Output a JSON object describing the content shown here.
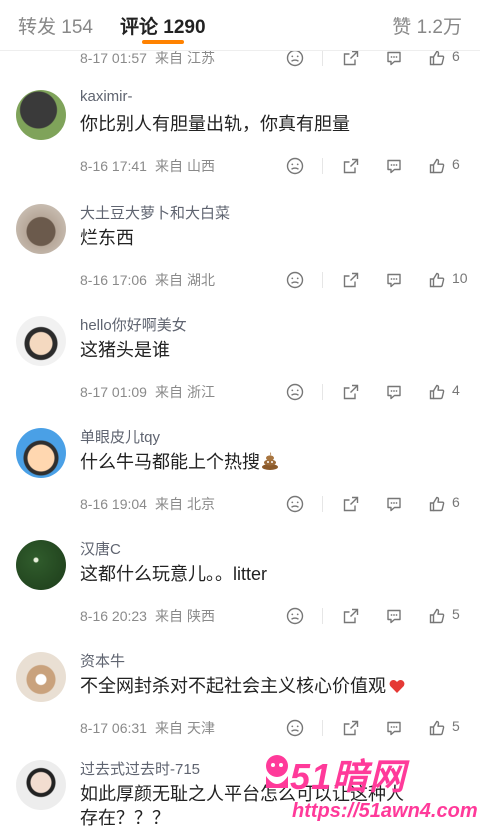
{
  "tabs": {
    "repost_label": "转发 154",
    "comments_label": "评论 1290",
    "likes_label": "赞 1.2万",
    "accent": "#ff8200"
  },
  "comments": [
    {
      "username": "",
      "text": "",
      "date": "8-17 01:57",
      "from": "来自",
      "location": "江苏",
      "likes": "6"
    },
    {
      "username": "kaximir-",
      "text": "你比别人有胆量出轨，你真有胆量",
      "date": "8-16 17:41",
      "from": "来自",
      "location": "山西",
      "likes": "6"
    },
    {
      "username": "大土豆大萝卜和大白菜",
      "text": "烂东西",
      "date": "8-16 17:06",
      "from": "来自",
      "location": "湖北",
      "likes": "10"
    },
    {
      "username": "hello你好啊美女",
      "text": "这猪头是谁",
      "date": "8-17 01:09",
      "from": "来自",
      "location": "浙江",
      "likes": "4"
    },
    {
      "username": "单眼皮儿tqy",
      "text": "什么牛马都能上个热搜",
      "date": "8-16 19:04",
      "from": "来自",
      "location": "北京",
      "likes": "6"
    },
    {
      "username": "汉唐C",
      "text": "这都什么玩意儿。。litter",
      "date": "8-16 20:23",
      "from": "来自",
      "location": "陕西",
      "likes": "5"
    },
    {
      "username": "资本牛",
      "text": "不全网封杀对不起社会主义核心价值观",
      "date": "8-17 06:31",
      "from": "来自",
      "location": "天津",
      "likes": "5"
    },
    {
      "username": "过去式过去时-715",
      "text": "如此厚颜无耻之人平台怎么可以让这种人",
      "text2": "存在？？？"
    }
  ],
  "icons": {
    "dislike": "dislike-face-icon",
    "comment": "comment-bubble-icon",
    "share": "share-icon",
    "like": "thumb-up-icon"
  },
  "watermark": {
    "logo": "51暗网",
    "url": "https://51awn4.com",
    "color": "#ff3a9a"
  }
}
